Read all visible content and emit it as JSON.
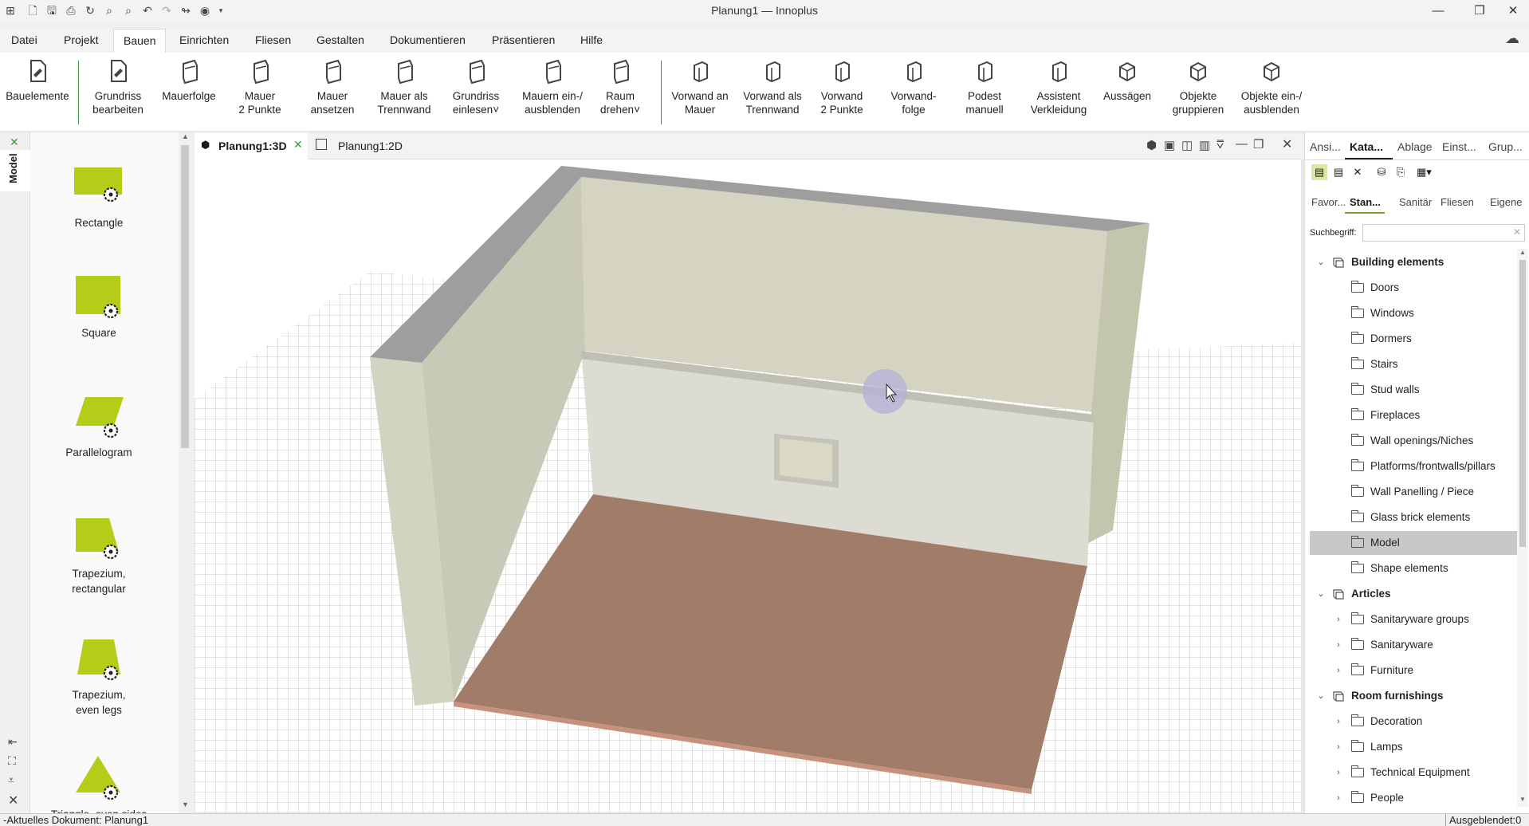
{
  "window": {
    "title": "Planung1 — Innoplus",
    "minimize_icon": "minimize-icon",
    "maximize_icon": "restore-icon",
    "close_icon": "close-icon"
  },
  "menu": {
    "items": [
      "Datei",
      "Projekt",
      "Bauen",
      "Einrichten",
      "Fliesen",
      "Gestalten",
      "Dokumentieren",
      "Präsentieren",
      "Hilfe"
    ],
    "active": "Bauen"
  },
  "ribbon": {
    "buttons": [
      {
        "l1": "Bauelemente",
        "l2": ""
      },
      {
        "l1": "Grundriss",
        "l2": "bearbeiten"
      },
      {
        "l1": "Mauerfolge",
        "l2": ""
      },
      {
        "l1": "Mauer",
        "l2": "2 Punkte"
      },
      {
        "l1": "Mauer",
        "l2": "ansetzen"
      },
      {
        "l1": "Mauer als",
        "l2": "Trennwand"
      },
      {
        "l1": "Grundriss",
        "l2": "einlesen˅"
      },
      {
        "l1": "Mauern ein-/",
        "l2": "ausblenden"
      },
      {
        "l1": "Raum",
        "l2": "drehen˅"
      },
      {
        "l1": "Vorwand an",
        "l2": "Mauer"
      },
      {
        "l1": "Vorwand als",
        "l2": "Trennwand"
      },
      {
        "l1": "Vorwand",
        "l2": "2 Punkte"
      },
      {
        "l1": "Vorwand-",
        "l2": "folge"
      },
      {
        "l1": "Podest",
        "l2": "manuell"
      },
      {
        "l1": "Assistent",
        "l2": "Verkleidung"
      },
      {
        "l1": "Aussägen",
        "l2": ""
      },
      {
        "l1": "Objekte",
        "l2": "gruppieren"
      },
      {
        "l1": "Objekte ein-/",
        "l2": "ausblenden"
      }
    ]
  },
  "left_panel": {
    "side_tab": "Model",
    "shapes": [
      {
        "l1": "Rectangle",
        "l2": ""
      },
      {
        "l1": "Square",
        "l2": ""
      },
      {
        "l1": "Parallelogram",
        "l2": ""
      },
      {
        "l1": "Trapezium,",
        "l2": "rectangular"
      },
      {
        "l1": "Trapezium,",
        "l2": "even legs"
      },
      {
        "l1": "Triangle, even sides",
        "l2": ""
      }
    ]
  },
  "view_tabs": {
    "tab1": "Planung1:3D",
    "tab2": "Planung1:2D"
  },
  "right_panel": {
    "tabs": [
      "Ansi...",
      "Kata...",
      "Ablage",
      "Einst...",
      "Grup..."
    ],
    "active_tab": "Kata...",
    "subtabs": [
      "Favor...",
      "Stan...",
      "Sanitär",
      "Fliesen",
      "Eigene"
    ],
    "active_subtab": "Stan...",
    "search_label": "Suchbegriff:",
    "search_value": "",
    "tree": [
      {
        "label": "Building elements",
        "level": 0,
        "expanded": true
      },
      {
        "label": "Doors",
        "level": 1
      },
      {
        "label": "Windows",
        "level": 1
      },
      {
        "label": "Dormers",
        "level": 1
      },
      {
        "label": "Stairs",
        "level": 1
      },
      {
        "label": "Stud walls",
        "level": 1
      },
      {
        "label": "Fireplaces",
        "level": 1
      },
      {
        "label": "Wall openings/Niches",
        "level": 1
      },
      {
        "label": "Platforms/frontwalls/pillars",
        "level": 1
      },
      {
        "label": "Wall Panelling / Piece",
        "level": 1
      },
      {
        "label": "Glass brick elements",
        "level": 1
      },
      {
        "label": "Model",
        "level": 1,
        "selected": true
      },
      {
        "label": "Shape elements",
        "level": 1
      },
      {
        "label": "Articles",
        "level": 0,
        "expanded": true
      },
      {
        "label": "Sanitaryware groups",
        "level": 1,
        "collapsed": true
      },
      {
        "label": "Sanitaryware",
        "level": 1,
        "collapsed": true
      },
      {
        "label": "Furniture",
        "level": 1,
        "collapsed": true
      },
      {
        "label": "Room furnishings",
        "level": 0,
        "expanded": true
      },
      {
        "label": "Decoration",
        "level": 1,
        "collapsed": true
      },
      {
        "label": "Lamps",
        "level": 1,
        "collapsed": true
      },
      {
        "label": "Technical Equipment",
        "level": 1,
        "collapsed": true
      },
      {
        "label": "People",
        "level": 1,
        "collapsed": true
      }
    ]
  },
  "status": {
    "left": "-Aktuelles Dokument: Planung1",
    "right": "Ausgeblendet:0"
  },
  "colors": {
    "accent_green": "#b5cc18",
    "floor": "#a07c69",
    "wall": "#d4d5c0",
    "selection": "#c8c8c8"
  }
}
